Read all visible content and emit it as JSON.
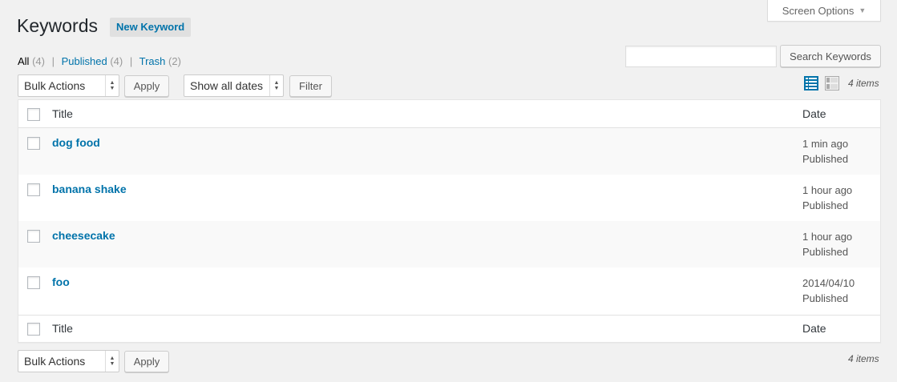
{
  "screen_options": {
    "label": "Screen Options"
  },
  "header": {
    "title": "Keywords",
    "add_new": "New Keyword"
  },
  "filters": [
    {
      "label": "All",
      "count": "(4)"
    },
    {
      "label": "Published",
      "count": "(4)"
    },
    {
      "label": "Trash",
      "count": "(2)"
    }
  ],
  "search": {
    "value": "",
    "button": "Search Keywords"
  },
  "top_nav": {
    "bulk_actions": "Bulk Actions",
    "apply": "Apply",
    "dates": "Show all dates",
    "filter": "Filter",
    "displaying": "4 items"
  },
  "table": {
    "columns": {
      "title": "Title",
      "date": "Date"
    },
    "rows": [
      {
        "title": "dog food",
        "date": "1 min ago",
        "status": "Published"
      },
      {
        "title": "banana shake",
        "date": "1 hour ago",
        "status": "Published"
      },
      {
        "title": "cheesecake",
        "date": "1 hour ago",
        "status": "Published"
      },
      {
        "title": "foo",
        "date": "2014/04/10",
        "status": "Published"
      }
    ]
  },
  "bottom_nav": {
    "bulk_actions": "Bulk Actions",
    "apply": "Apply",
    "displaying": "4 items"
  },
  "icons": {
    "list_view": "list-view-icon",
    "excerpt_view": "excerpt-view-icon"
  },
  "colors": {
    "link": "#0073aa",
    "background": "#f1f1f1"
  }
}
